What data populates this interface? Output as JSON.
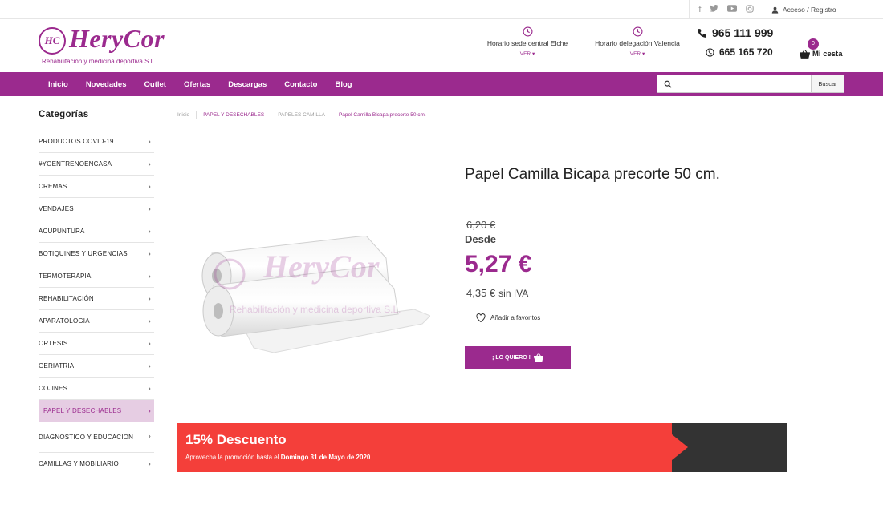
{
  "topbar": {
    "social_icons": [
      "facebook-icon",
      "twitter-icon",
      "youtube-icon",
      "instagram-icon"
    ],
    "account_label": "Acceso / Registro"
  },
  "logo": {
    "mark": "HC",
    "brand": "HeryCor",
    "subtitle": "Rehabilitación y medicina deportiva S.L."
  },
  "header": {
    "hours1_label": "Horario sede central Elche",
    "hours2_label": "Horario delegación Valencia",
    "ver_label": "VER",
    "phone": "965 111 999",
    "whatsapp": "665 165 720",
    "cart_count": "0",
    "cart_label": "Mi cesta"
  },
  "nav": {
    "items": [
      "Inicio",
      "Novedades",
      "Outlet",
      "Ofertas",
      "Descargas",
      "Contacto",
      "Blog"
    ],
    "search_placeholder": "",
    "search_button": "Buscar"
  },
  "sidebar": {
    "title": "Categorías",
    "items": [
      "PRODUCTOS COVID-19",
      "#YOENTRENOENCASA",
      "CREMAS",
      "VENDAJES",
      "ACUPUNTURA",
      "BOTIQUINES Y URGENCIAS",
      "TERMOTERAPIA",
      "REHABILITACIÓN",
      "APARATOLOGIA",
      "ORTESIS",
      "GERIATRIA",
      "COJINES",
      "PAPEL Y DESECHABLES",
      "DIAGNOSTICO Y EDUCACION",
      "CAMILLAS Y MOBILIARIO"
    ],
    "active_index": 12
  },
  "breadcrumb": [
    "Inicio",
    "PAPEL Y DESECHABLES",
    "PAPELES CAMILLA",
    "Papel Camilla Bicapa precorte 50 cm."
  ],
  "product": {
    "title": "Papel Camilla Bicapa precorte 50 cm.",
    "old_price": "6,20 €",
    "desde": "Desde",
    "price": "5,27 €",
    "price_no_vat": "4,35 €",
    "no_vat_label": "sin IVA",
    "favorite_label": "Añadir a favoritos",
    "buy_label": "¡ LO QUIERO !"
  },
  "promo": {
    "title": "15% Descuento",
    "text": "Aprovecha la promoción hasta el",
    "date": "Domingo 31 de Mayo de 2020"
  },
  "colors": {
    "brand": "#9b2a8e",
    "promo_red": "#f43f3a",
    "promo_dark": "#333333"
  }
}
